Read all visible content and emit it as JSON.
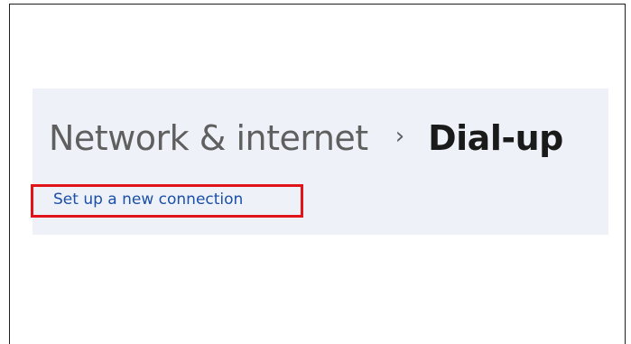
{
  "breadcrumb": {
    "parent": "Network & internet",
    "separator": "›",
    "current": "Dial-up"
  },
  "actions": {
    "setup_link": "Set up a new connection"
  },
  "colors": {
    "panel_bg": "#eef2f8",
    "link": "#1b4fa8",
    "highlight": "#e0141a"
  }
}
